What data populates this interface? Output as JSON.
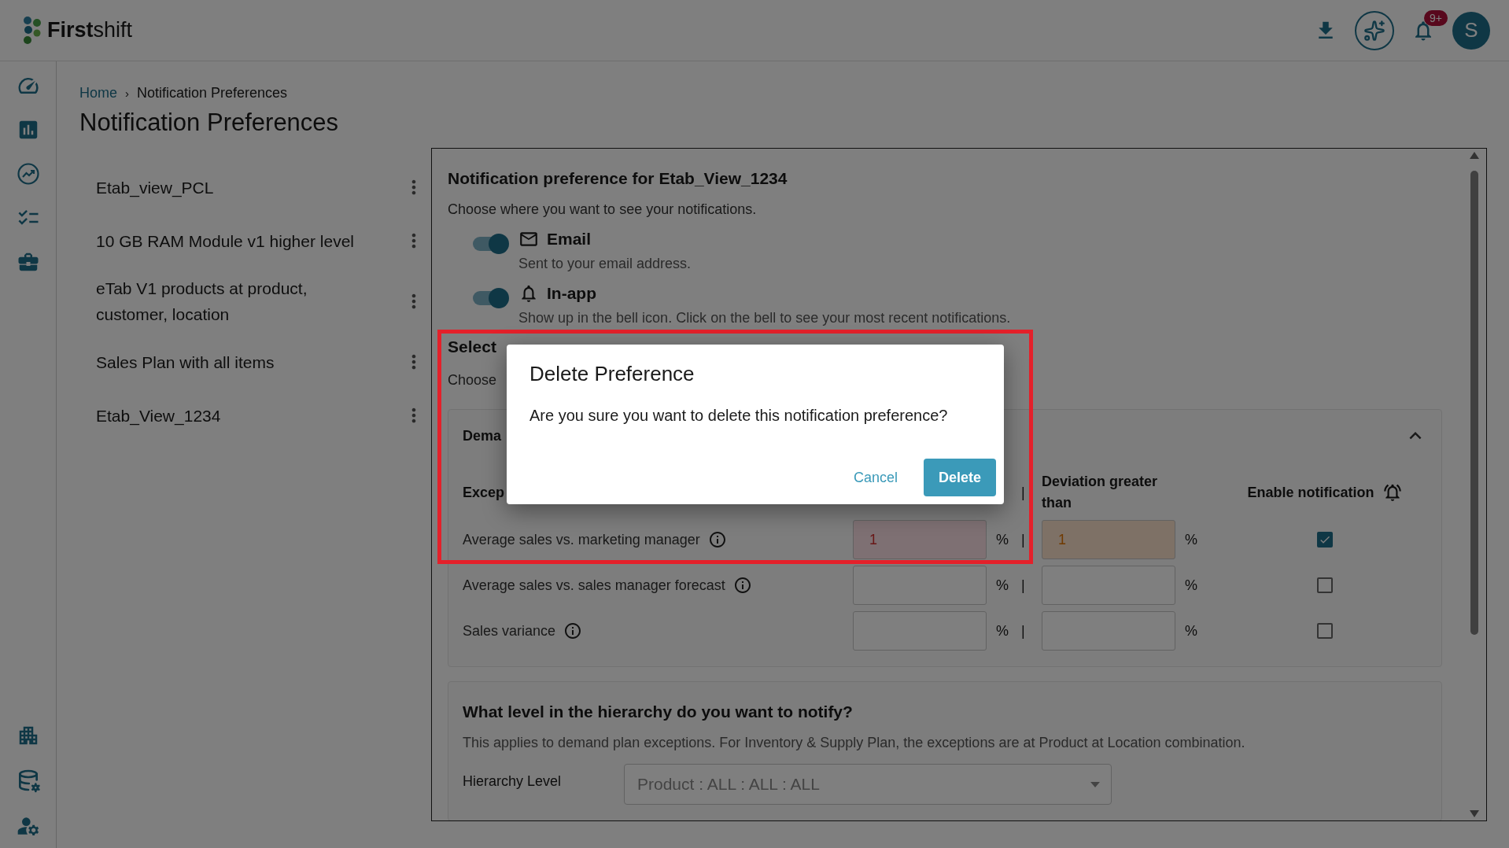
{
  "app": {
    "brand": "**First**shift",
    "notification_badge": "9+",
    "avatar": "S"
  },
  "breadcrumb": [
    {
      "label": "Home",
      "kind": "link"
    },
    {
      "label": "›",
      "kind": "separator"
    },
    {
      "label": "Notification Preferences",
      "kind": "current"
    }
  ],
  "page_title": "Notification Preferences",
  "preferences": [
    {
      "name": "Etab_view_PCL"
    },
    {
      "name": "10 GB RAM Module v1 higher level"
    },
    {
      "name": "eTab V1 products at product, customer, location"
    },
    {
      "name": "Sales Plan with all items"
    },
    {
      "name": "Etab_View_1234"
    }
  ],
  "panel": {
    "title": "Notification preference for Etab_View_1234",
    "subtitle": "Choose where you want to see your notifications.",
    "channels": [
      {
        "kind": "email",
        "name": "Email",
        "description": "Sent to your email address.",
        "on": true
      },
      {
        "kind": "inapp",
        "name": "In-app",
        "description": "Show up in the bell icon. Click on the bell to see your most recent notifications.",
        "on": true
      }
    ],
    "select_heading": "Select",
    "select_hint": "Choose",
    "demand_card": {
      "title": "Dema",
      "expanded": true,
      "columns": {
        "exception": "Excep",
        "divider": "|",
        "deviation": "Deviation greater than",
        "enable": "Enable notification"
      },
      "rows": [
        {
          "name": "Average sales vs. marketing manager",
          "thresholds": [
            {
              "value": "1",
              "error": true,
              "warning": false,
              "unit": "%"
            },
            {
              "value": "1",
              "error": false,
              "warning": true,
              "unit": "%"
            }
          ],
          "divider": "|",
          "checked": true
        },
        {
          "name": "Average sales vs. sales manager forecast",
          "thresholds": [
            {
              "error": false,
              "warning": false,
              "unit": "%"
            },
            {
              "error": false,
              "warning": false,
              "unit": "%"
            }
          ],
          "divider": "|",
          "checked": false
        },
        {
          "name": "Sales variance",
          "thresholds": [
            {
              "error": false,
              "warning": false,
              "unit": "%"
            },
            {
              "error": false,
              "warning": false,
              "unit": "%"
            }
          ],
          "divider": "|",
          "checked": false
        }
      ]
    },
    "hierarchy_card": {
      "title": "What level in the hierarchy do you want to notify?",
      "note": "This applies to demand plan exceptions. For Inventory & Supply Plan, the exceptions are at Product at Location combination.",
      "label": "Hierarchy Level",
      "value": "Product : ALL : ALL : ALL"
    }
  },
  "dialog": {
    "title": "Delete Preference",
    "message": "Are you sure you want to delete this notification preference?",
    "buttons": [
      {
        "label": "Cancel",
        "kind": "text"
      },
      {
        "label": "Delete",
        "kind": "primary"
      }
    ]
  }
}
